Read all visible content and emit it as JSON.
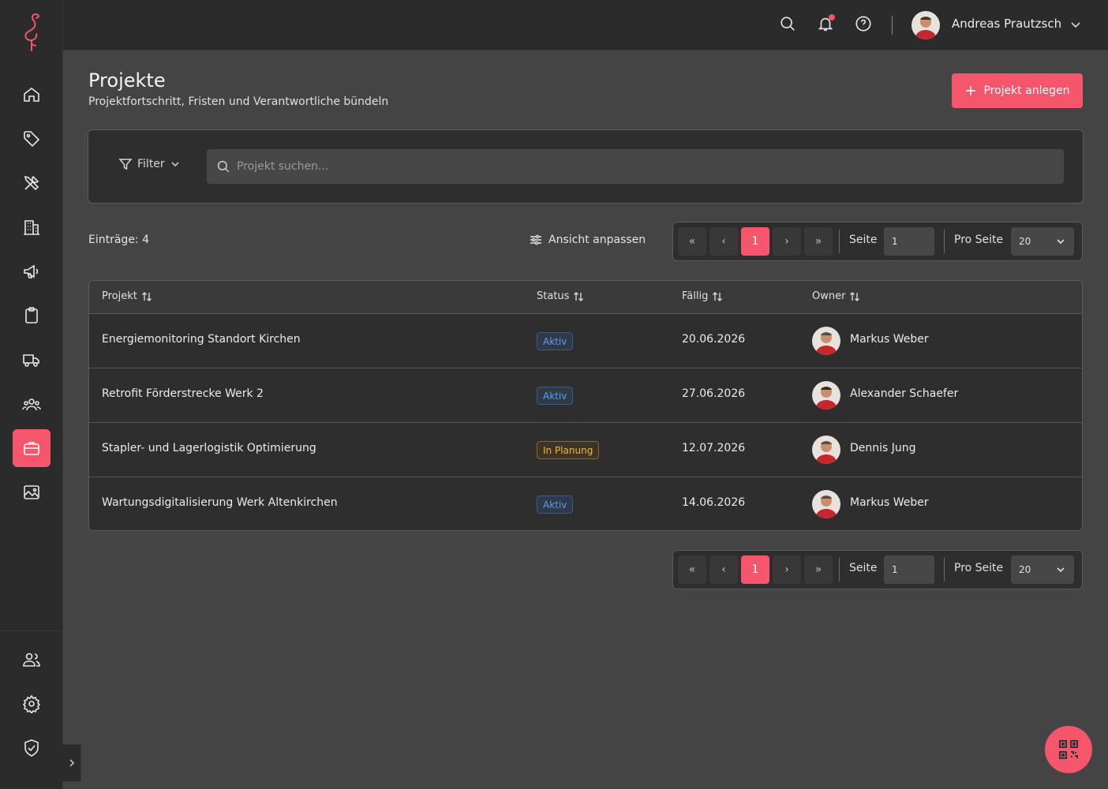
{
  "user": {
    "name": "Andreas Prautzsch"
  },
  "page": {
    "title": "Projekte",
    "subtitle": "Projektfortschritt, Fristen und Verantwortliche bündeln",
    "create_button": "Projekt anlegen"
  },
  "filter": {
    "label": "Filter",
    "search_placeholder": "Projekt suchen..."
  },
  "toolbar": {
    "entries": "Einträge: 4",
    "customize": "Ansicht anpassen"
  },
  "pagination": {
    "first": "«",
    "prev": "‹",
    "next": "›",
    "last": "»",
    "current_page": "1",
    "page_label": "Seite",
    "page_input": "1",
    "per_page_label": "Pro Seite",
    "per_page_value": "20"
  },
  "table": {
    "columns": [
      "Projekt",
      "Status",
      "Fällig",
      "Owner"
    ],
    "rows": [
      {
        "project": "Energiemonitoring Standort Kirchen",
        "status": "Aktiv",
        "due": "20.06.2026",
        "owner": "Markus Weber"
      },
      {
        "project": "Retrofit Förderstrecke Werk 2",
        "status": "Aktiv",
        "due": "27.06.2026",
        "owner": "Alexander Schaefer"
      },
      {
        "project": "Stapler- und Lagerlogistik Optimierung",
        "status": "In Planung",
        "due": "12.07.2026",
        "owner": "Dennis Jung"
      },
      {
        "project": "Wartungsdigitalisierung Werk Altenkirchen",
        "status": "Aktiv",
        "due": "14.06.2026",
        "owner": "Markus Weber"
      }
    ]
  },
  "colors": {
    "accent": "#f5566b",
    "sidebar_bg": "#2b2b2b",
    "content_bg": "#444444",
    "status_active": "#5c9cf0",
    "status_planning": "#f0b53c"
  },
  "icons": {
    "sidebar": [
      "home-icon",
      "tag-icon",
      "tools-icon",
      "building-icon",
      "megaphone-icon",
      "clipboard-icon",
      "truck-icon",
      "team-icon",
      "briefcase-icon",
      "image-icon"
    ],
    "sidebar_bottom": [
      "users-icon",
      "gear-icon",
      "shield-icon"
    ],
    "topbar": [
      "search-icon",
      "bell-icon",
      "help-icon"
    ],
    "fab": "qr-code-icon"
  }
}
